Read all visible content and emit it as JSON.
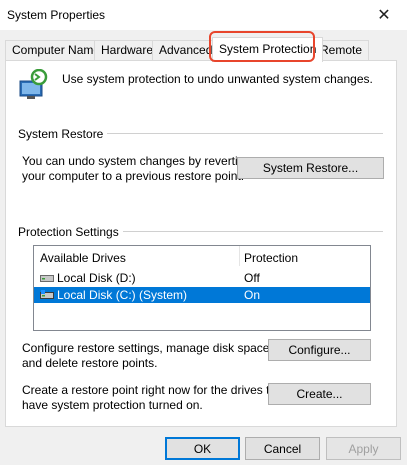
{
  "window": {
    "title": "System Properties",
    "close_glyph": "✕"
  },
  "tabs": [
    {
      "label": "Computer Name"
    },
    {
      "label": "Hardware"
    },
    {
      "label": "Advanced"
    },
    {
      "label": "System Protection",
      "active": true
    },
    {
      "label": "Remote"
    }
  ],
  "intro": {
    "text": "Use system protection to undo unwanted system changes.",
    "icon": "system-protection-icon"
  },
  "system_restore": {
    "title": "System Restore",
    "description_line1": "You can undo system changes by reverting",
    "description_line2": "your computer to a previous restore point.",
    "button_label": "System Restore..."
  },
  "protection": {
    "title": "Protection Settings",
    "columns": {
      "drives": "Available Drives",
      "protection": "Protection"
    },
    "rows": [
      {
        "drive": "Local Disk (D:)",
        "protection": "Off",
        "icon": "drive-icon",
        "selected": false
      },
      {
        "drive": "Local Disk (C:) (System)",
        "protection": "On",
        "icon": "system-drive-icon",
        "selected": true
      }
    ],
    "configure_line1": "Configure restore settings, manage disk space,",
    "configure_line2": "and delete restore points.",
    "configure_label": "Configure...",
    "create_line1": "Create a restore point right now for the drives that",
    "create_line2": "have system protection turned on.",
    "create_label": "Create..."
  },
  "footer": {
    "ok_label": "OK",
    "cancel_label": "Cancel",
    "apply_label": "Apply"
  },
  "colors": {
    "selection": "#0078d7",
    "highlight": "#e8452c",
    "panel": "#ffffff",
    "chrome": "#f0f0f0"
  }
}
